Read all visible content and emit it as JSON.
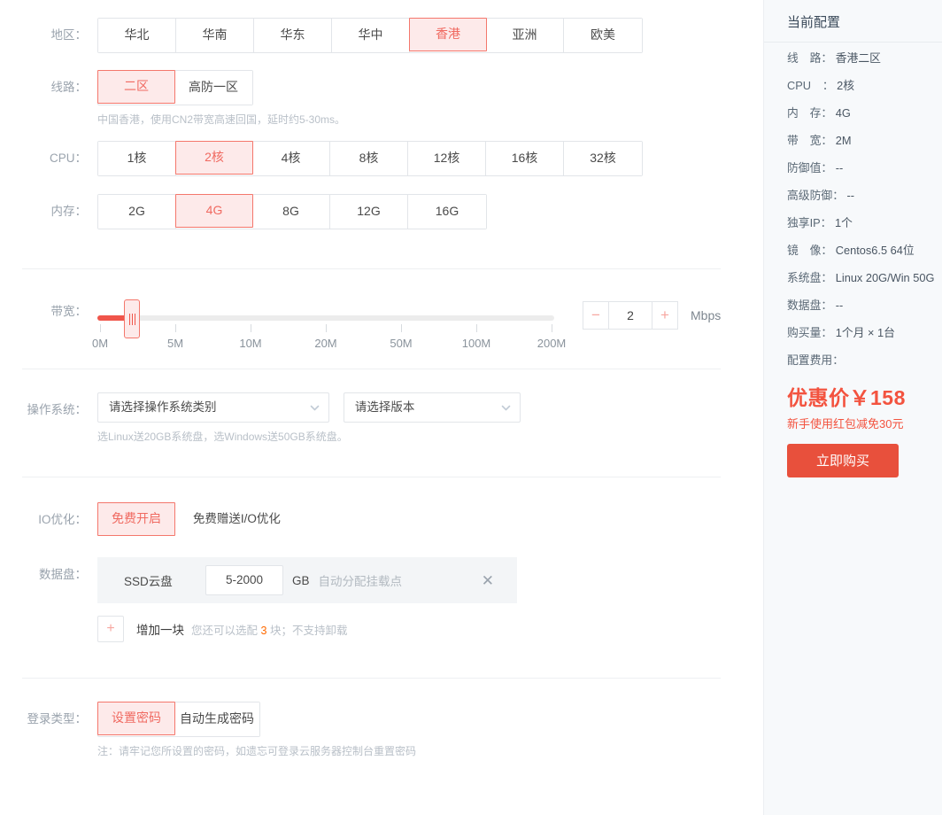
{
  "region": {
    "label": "地区：",
    "options": [
      "华北",
      "华南",
      "华东",
      "华中",
      "香港",
      "亚洲",
      "欧美"
    ],
    "selected": "香港"
  },
  "line": {
    "label": "线路：",
    "options": [
      "二区",
      "高防一区"
    ],
    "selected": "二区",
    "hint": "中国香港，使用CN2带宽高速回国，延时约5-30ms。"
  },
  "cpu": {
    "label": "CPU：",
    "options": [
      "1核",
      "2核",
      "4核",
      "8核",
      "12核",
      "16核",
      "32核"
    ],
    "selected": "2核"
  },
  "memory": {
    "label": "内存：",
    "options": [
      "2G",
      "4G",
      "8G",
      "12G",
      "16G"
    ],
    "selected": "4G"
  },
  "bandwidth": {
    "label": "带宽：",
    "ticks": [
      "0M",
      "5M",
      "10M",
      "20M",
      "50M",
      "100M",
      "200M"
    ],
    "value": "2",
    "unit": "Mbps",
    "minus": "−",
    "plus": "+"
  },
  "os": {
    "label": "操作系统：",
    "category_value": "请选择操作系统类别",
    "version_value": "请选择版本",
    "hint": "选Linux送20GB系统盘，选Windows送50GB系统盘。"
  },
  "io": {
    "label": "IO优化：",
    "options": [
      "免费开启"
    ],
    "selected": "免费开启",
    "note": "免费赠送I/O优化"
  },
  "disk": {
    "label": "数据盘：",
    "type": "SSD云盘",
    "size": "5-2000",
    "unit": "GB",
    "mount_placeholder": "自动分配挂载点",
    "remove_icon": "✕",
    "add_icon": "+",
    "add_label": "增加一块",
    "add_hint_before": "您还可以选配",
    "add_hint_count": "3",
    "add_hint_after": "块；不支持卸载"
  },
  "login": {
    "label": "登录类型：",
    "options": [
      "设置密码",
      "自动生成密码"
    ],
    "selected": "设置密码",
    "note": "注：请牢记您所设置的密码，如遗忘可登录云服务器控制台重置密码"
  },
  "summary": {
    "title": "当前配置",
    "items": [
      {
        "key": "线　路：",
        "value": "香港二区"
      },
      {
        "key": "CPU　：",
        "value": "2核"
      },
      {
        "key": "内　存：",
        "value": "4G"
      },
      {
        "key": "带　宽：",
        "value": "2M"
      },
      {
        "key": "防御值：",
        "value": "--"
      },
      {
        "key": "高级防御：",
        "value": "--"
      },
      {
        "key": "独享IP：",
        "value": "1个"
      },
      {
        "key": "镜　像：",
        "value": "Centos6.5 64位"
      },
      {
        "key": "系统盘：",
        "value": "Linux 20G/Win 50G"
      },
      {
        "key": "数据盘：",
        "value": "--"
      },
      {
        "key": "购买量：",
        "value": "1个月 × 1台"
      },
      {
        "key": "配置费用：",
        "value": ""
      }
    ],
    "price": "优惠价￥158",
    "price_sub": "新手使用红包减免30元",
    "buy_label": "立即购买"
  },
  "colors": {
    "accent_red": "#f0554a",
    "selected_bg": "#fdeaea",
    "selected_border": "#f4776c",
    "buy_button": "#e8503c",
    "panel_bg": "#f7f9fb",
    "hint_text": "#b9c0c8"
  }
}
